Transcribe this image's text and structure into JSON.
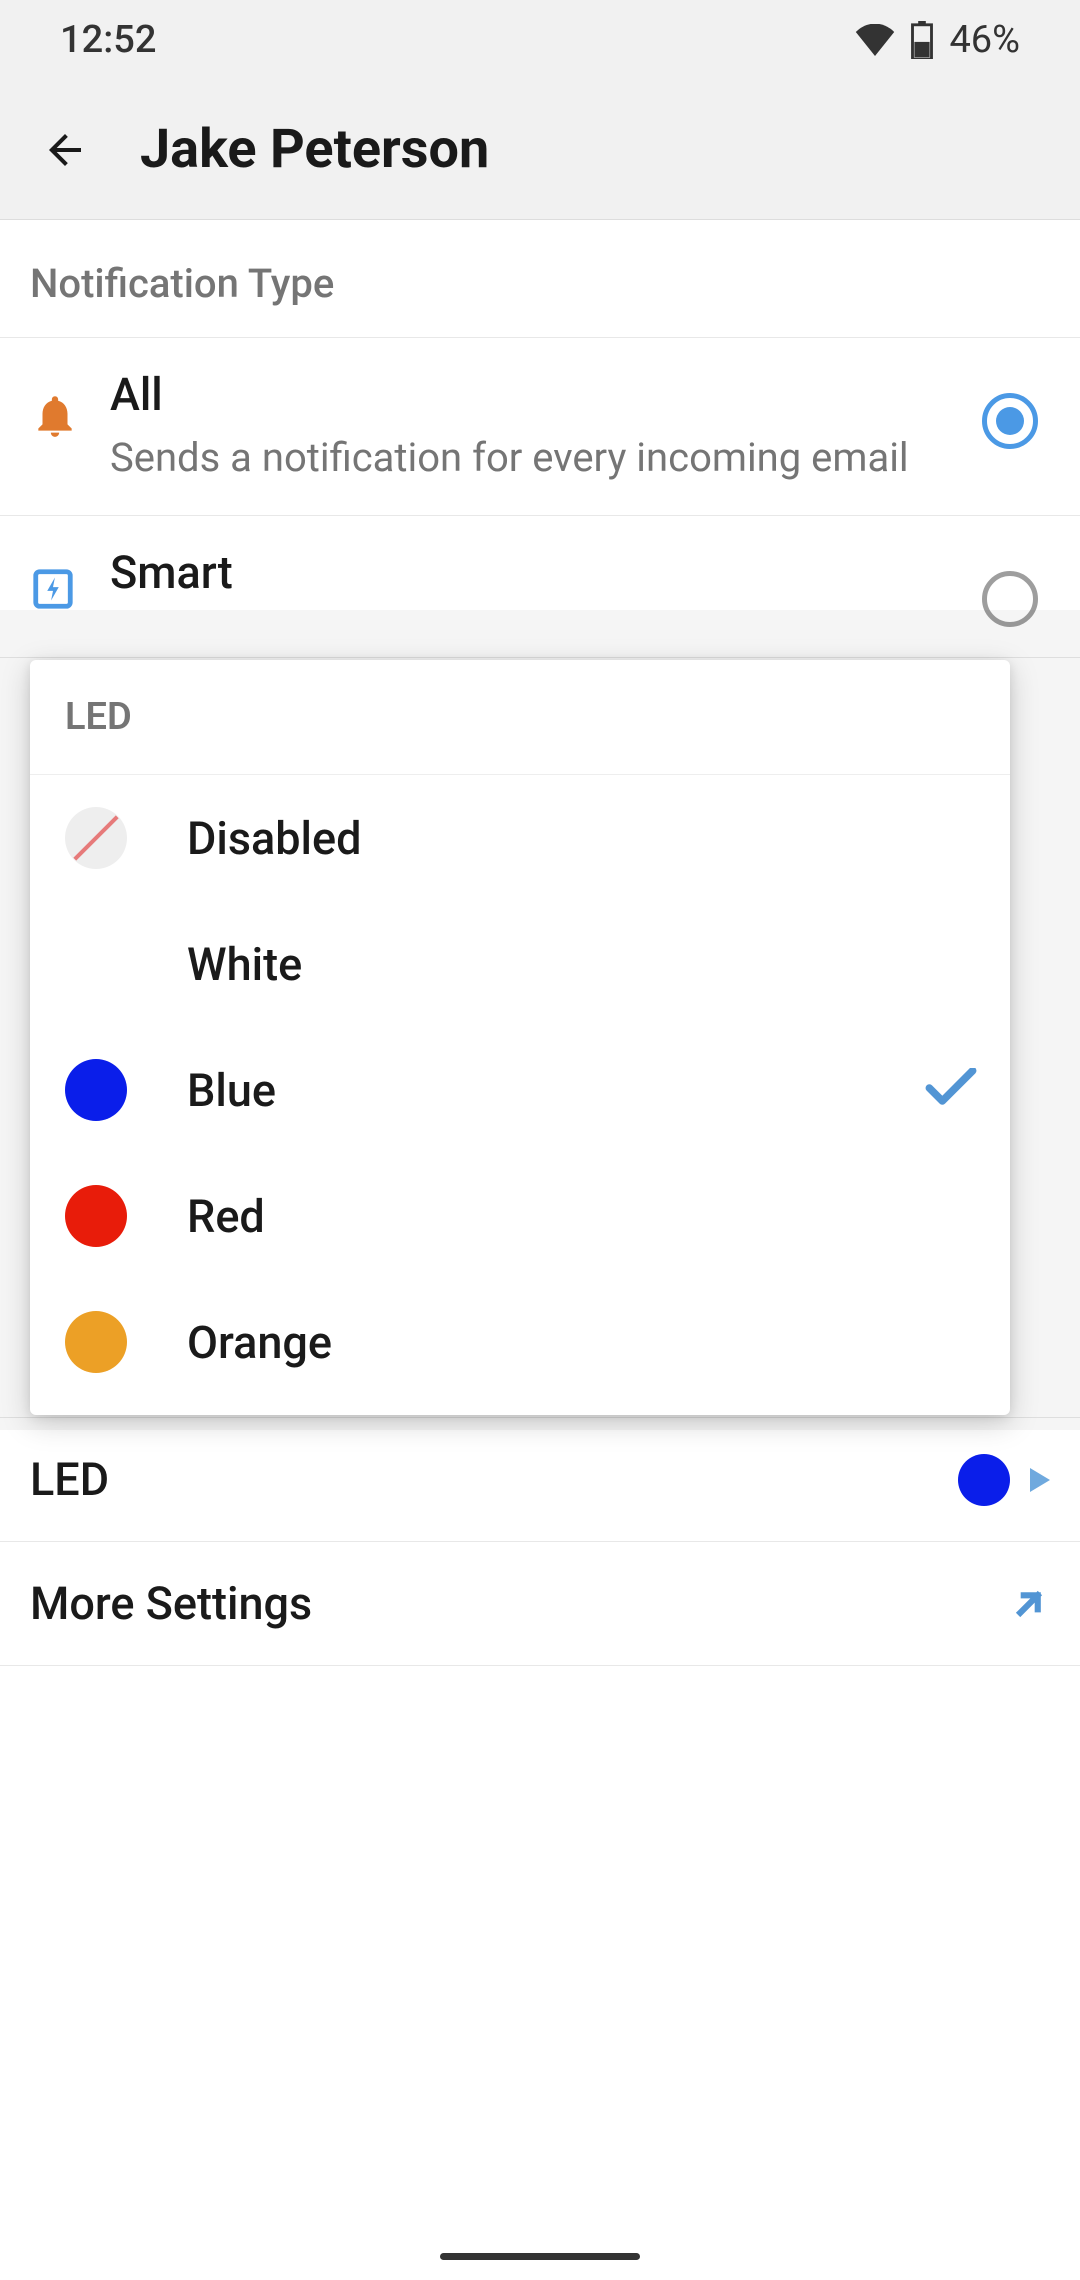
{
  "status": {
    "time": "12:52",
    "battery": "46%"
  },
  "header": {
    "title": "Jake Peterson"
  },
  "notificationSection": {
    "label": "Notification Type",
    "options": [
      {
        "title": "All",
        "desc": "Sends a notification for every incoming email",
        "selected": true
      },
      {
        "title": "Smart",
        "desc": "",
        "selected": false
      }
    ]
  },
  "ledPopup": {
    "title": "LED",
    "options": [
      {
        "label": "Disabled",
        "color": "",
        "kind": "disabled",
        "selected": false
      },
      {
        "label": "White",
        "color": "",
        "kind": "empty",
        "selected": false
      },
      {
        "label": "Blue",
        "color": "#0a1eea",
        "kind": "color",
        "selected": true
      },
      {
        "label": "Red",
        "color": "#e81c0a",
        "kind": "color",
        "selected": false
      },
      {
        "label": "Orange",
        "color": "#eca026",
        "kind": "color",
        "selected": false
      }
    ]
  },
  "settings": {
    "led": {
      "label": "LED",
      "color": "#0a1eea"
    },
    "more": {
      "label": "More Settings"
    }
  }
}
